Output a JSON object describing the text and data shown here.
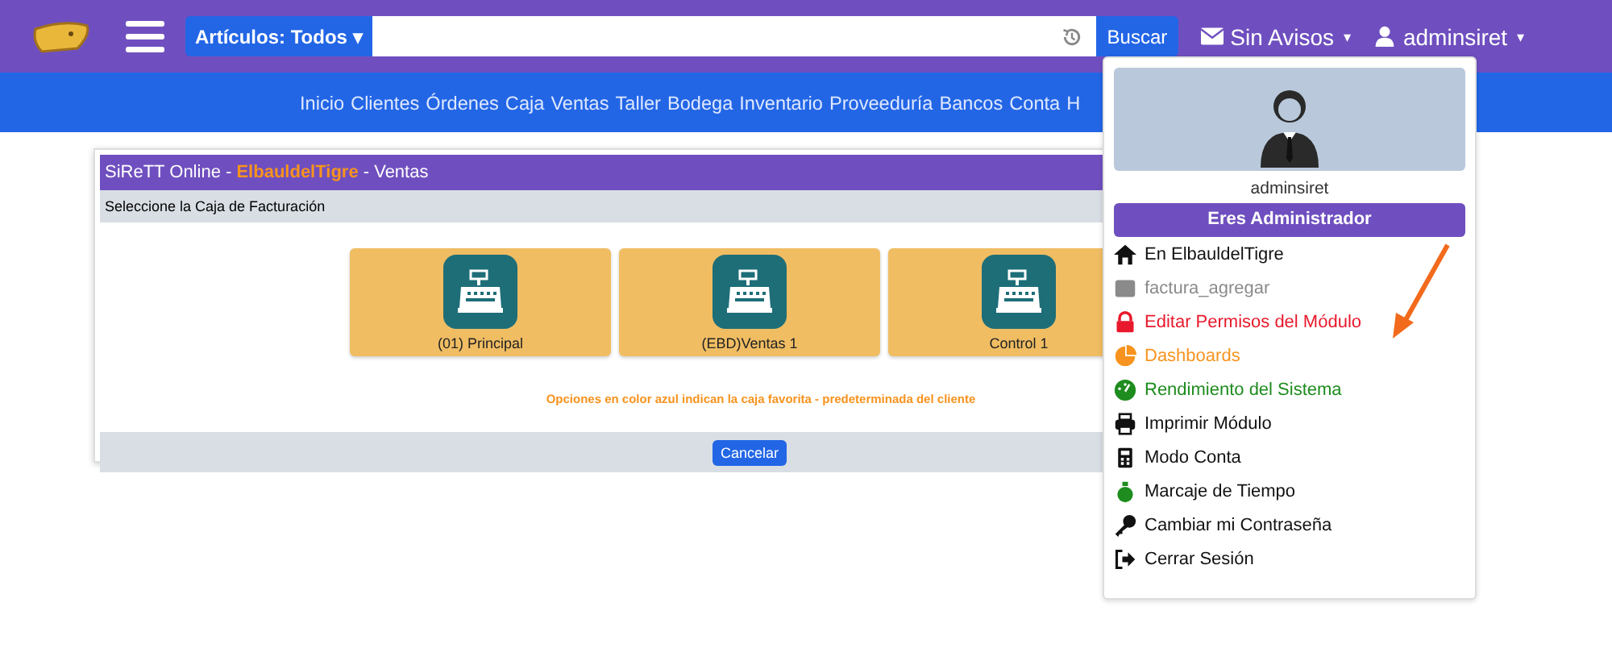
{
  "topbar": {
    "search_scope": "Artículos: Todos",
    "caret": "▾",
    "search_button": "Buscar",
    "notices": "Sin Avisos",
    "user": "adminsiret"
  },
  "nav": [
    "Inicio",
    "Clientes",
    "Órdenes",
    "Caja",
    "Ventas",
    "Taller",
    "Bodega",
    "Inventario",
    "Proveeduría",
    "Bancos",
    "Conta",
    "H"
  ],
  "dialog": {
    "title_prefix": "SiReTT Online - ",
    "title_company": "ElbauldelTigre",
    "title_suffix": " - Ventas",
    "subtitle": "Seleccione la Caja de Facturación",
    "registers": [
      {
        "label": "(01) Principal",
        "favorite": false
      },
      {
        "label": "(EBD)Ventas 1",
        "favorite": false
      },
      {
        "label": "Control 1",
        "favorite": false
      }
    ],
    "note": "Opciones en color azul indican la caja favorita - predeterminada del cliente",
    "cancel": "Cancelar"
  },
  "user_menu": {
    "username": "adminsiret",
    "role": "Eres Administrador",
    "items": [
      {
        "label": "En ElbauldelTigre",
        "color": "#111111"
      },
      {
        "label": "factura_agregar",
        "color": "#8a8a8a"
      },
      {
        "label": "Editar Permisos del Módulo",
        "color": "#e8192c"
      },
      {
        "label": "Dashboards",
        "color": "#f7931e"
      },
      {
        "label": "Rendimiento del Sistema",
        "color": "#1e8c1e"
      },
      {
        "label": "Imprimir Módulo",
        "color": "#111111"
      },
      {
        "label": "Modo Conta",
        "color": "#111111"
      },
      {
        "label": "Marcaje de Tiempo",
        "color": "#111111"
      },
      {
        "label": "Cambiar mi Contraseña",
        "color": "#111111"
      },
      {
        "label": "Cerrar Sesión",
        "color": "#111111"
      }
    ]
  }
}
